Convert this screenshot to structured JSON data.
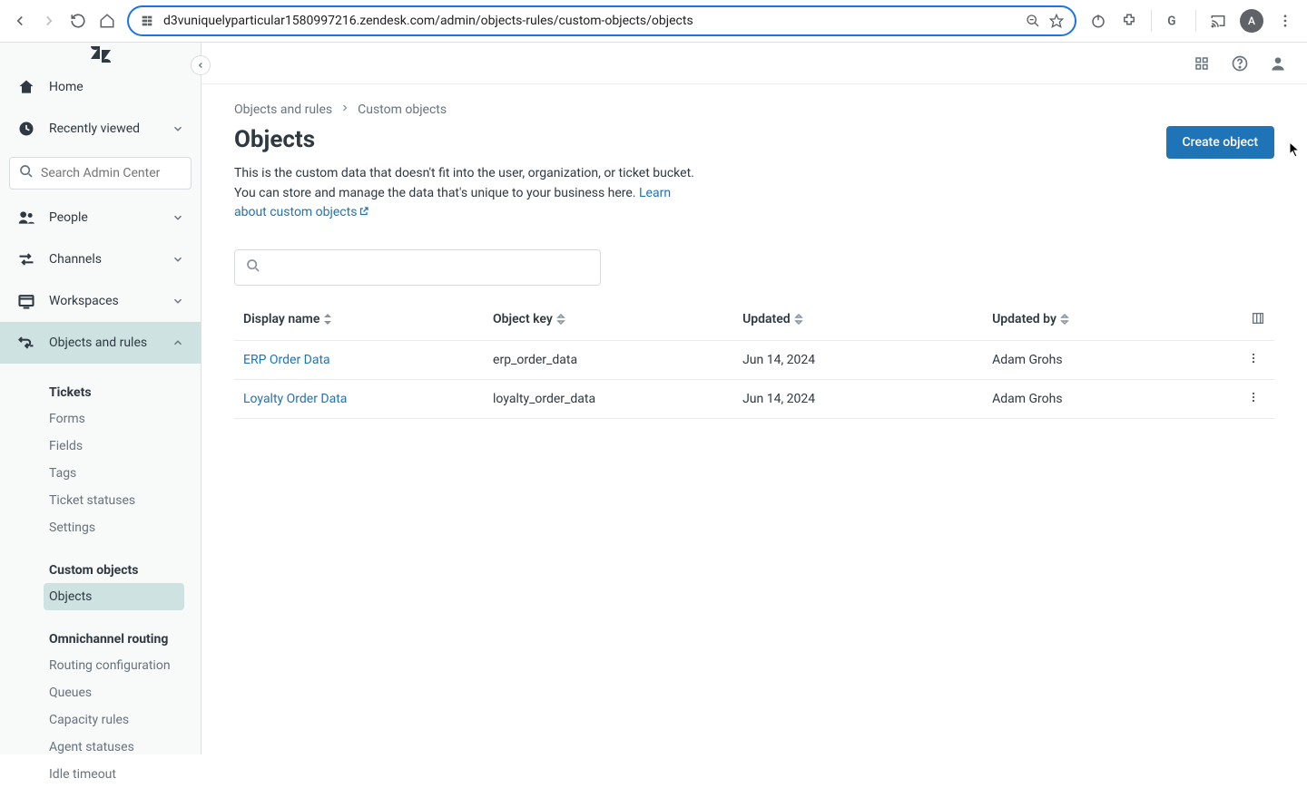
{
  "browser": {
    "url": "d3vuniquelyparticular1580997216.zendesk.com/admin/objects-rules/custom-objects/objects",
    "avatar_initial": "A"
  },
  "sidebar": {
    "home": "Home",
    "recent": "Recently viewed",
    "search_placeholder": "Search Admin Center",
    "people": "People",
    "channels": "Channels",
    "workspaces": "Workspaces",
    "objects_rules": "Objects and rules",
    "groups": {
      "tickets": {
        "heading": "Tickets",
        "items": [
          "Forms",
          "Fields",
          "Tags",
          "Ticket statuses",
          "Settings"
        ]
      },
      "custom_objects": {
        "heading": "Custom objects",
        "items": [
          "Objects"
        ]
      },
      "omnichannel": {
        "heading": "Omnichannel routing",
        "items": [
          "Routing configuration",
          "Queues",
          "Capacity rules",
          "Agent statuses",
          "Idle timeout"
        ]
      }
    }
  },
  "breadcrumb": {
    "a": "Objects and rules",
    "b": "Custom objects"
  },
  "page": {
    "title": "Objects",
    "create_label": "Create object",
    "desc1": "This is the custom data that doesn't fit into the user, organization, or ticket bucket.",
    "desc2": "You can store and manage the data that's unique to your business here. ",
    "learn_more": "Learn about custom objects"
  },
  "table": {
    "headers": {
      "display_name": "Display name",
      "object_key": "Object key",
      "updated": "Updated",
      "updated_by": "Updated by"
    },
    "rows": [
      {
        "display_name": "ERP Order Data",
        "object_key": "erp_order_data",
        "updated": "Jun 14, 2024",
        "updated_by": "Adam Grohs"
      },
      {
        "display_name": "Loyalty Order Data",
        "object_key": "loyalty_order_data",
        "updated": "Jun 14, 2024",
        "updated_by": "Adam Grohs"
      }
    ]
  }
}
